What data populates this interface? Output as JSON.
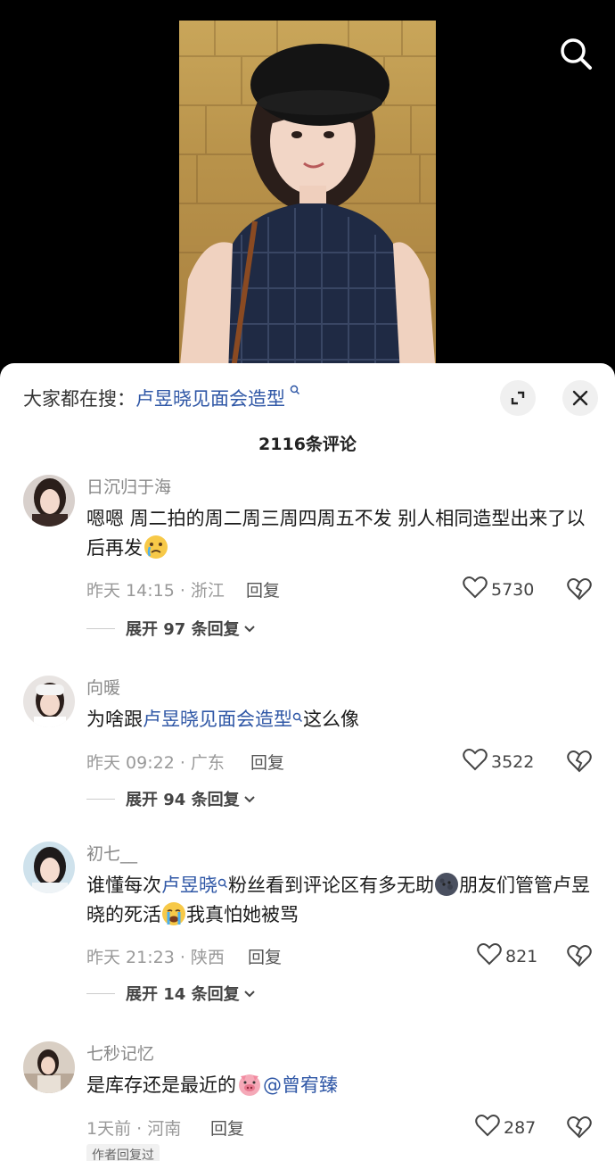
{
  "hot_search": {
    "prefix": "大家都在搜：",
    "keyword": "卢昱晓见面会造型"
  },
  "comment_count": "2116条评论",
  "comments": [
    {
      "user": "日沉归于海",
      "text_a": "嗯嗯 周二拍的周二周三周四周五不发 别人相同造型出来了以后再发",
      "time": "昨天 14:15 · 浙江",
      "reply": "回复",
      "likes": "5730",
      "expand": "展开 97 条回复"
    },
    {
      "user": "向暖",
      "text_a": "为啥跟",
      "text_kw": "卢昱晓见面会造型",
      "text_b": "这么像",
      "time": "昨天 09:22 · 广东",
      "reply": "回复",
      "likes": "3522",
      "expand": "展开 94 条回复"
    },
    {
      "user": "初七__",
      "text_a": "谁懂每次",
      "text_kw": "卢昱晓",
      "text_b": "粉丝看到评论区有多无助",
      "text_c": "朋友们管管卢昱晓的死活",
      "text_d": "我真怕她被骂",
      "time": "昨天 21:23 · 陕西",
      "reply": "回复",
      "likes": "821",
      "expand": "展开 14 条回复"
    },
    {
      "user": "七秒记忆",
      "text_a": "是库存还是最近的",
      "mention": "@曾宥臻",
      "time": "1天前 · 河南",
      "reply": "回复",
      "likes": "287",
      "author_tag": "作者回复过"
    }
  ],
  "icons": {
    "search": "search-icon",
    "expand": "expand-icon",
    "close": "close-icon",
    "heart": "heart-icon",
    "broken_heart": "broken-heart-icon",
    "chevron": "chevron-down-icon"
  },
  "colors": {
    "keyword_blue": "#2f57a6",
    "background": "#000000",
    "sheet": "#ffffff"
  }
}
